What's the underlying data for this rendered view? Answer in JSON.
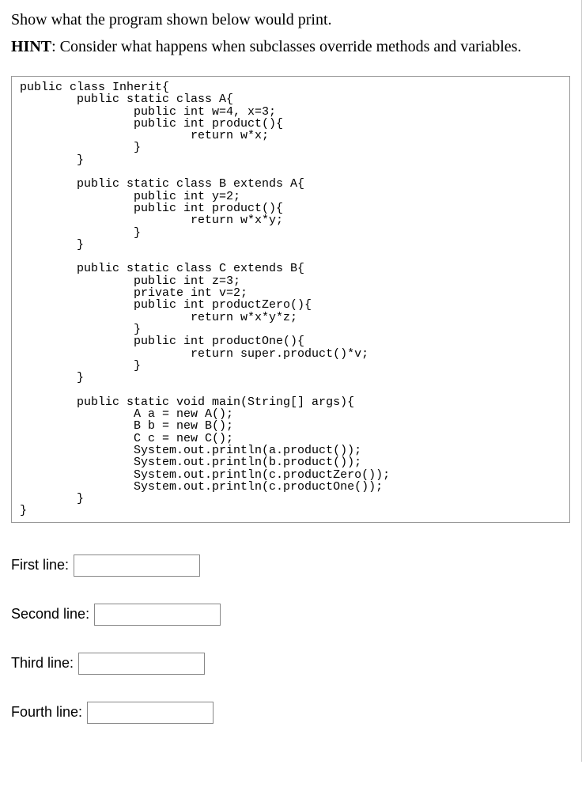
{
  "instruction": "Show what the program shown below would print.",
  "hint_label": "HINT",
  "hint_text": ": Consider what happens when subclasses override methods and variables.",
  "code": "public class Inherit{\n        public static class A{\n                public int w=4, x=3;\n                public int product(){\n                        return w*x;\n                }\n        }\n\n        public static class B extends A{\n                public int y=2;\n                public int product(){\n                        return w*x*y;\n                }\n        }\n\n        public static class C extends B{\n                public int z=3;\n                private int v=2;\n                public int productZero(){\n                        return w*x*y*z;\n                }\n                public int productOne(){\n                        return super.product()*v;\n                }\n        }\n\n        public static void main(String[] args){\n                A a = new A();\n                B b = new B();\n                C c = new C();\n                System.out.println(a.product());\n                System.out.println(b.product());\n                System.out.println(c.productZero());\n                System.out.println(c.productOne());\n        }\n}",
  "answers": {
    "first_label": "First line:",
    "second_label": "Second line:",
    "third_label": "Third line:",
    "fourth_label": "Fourth line:",
    "first_value": "",
    "second_value": "",
    "third_value": "",
    "fourth_value": ""
  }
}
